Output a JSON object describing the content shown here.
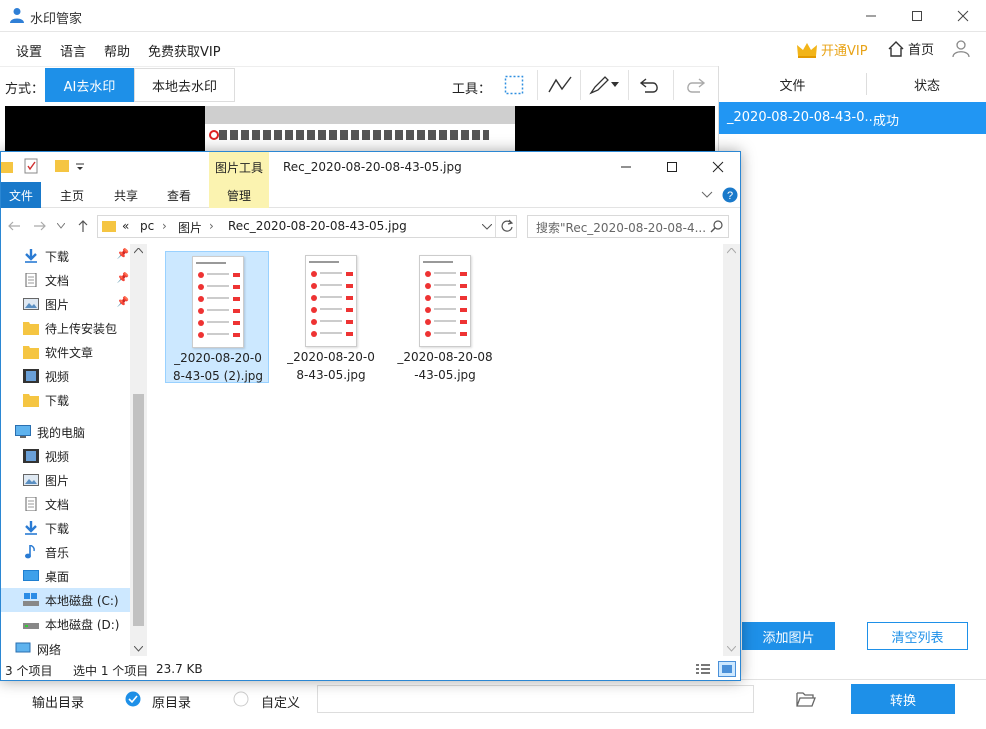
{
  "app": {
    "title": "水印管家",
    "menu": [
      "设置",
      "语言",
      "帮助",
      "免费获取VIP"
    ],
    "vip_label": "开通VIP",
    "home_label": "首页"
  },
  "toolbar": {
    "mode_label": "方式：",
    "modes": [
      "AI去水印",
      "本地去水印"
    ],
    "tools_label": "工具："
  },
  "file_list": {
    "headers": [
      "文件",
      "状态"
    ],
    "rows": [
      {
        "name": "_2020-08-20-08-43-0...",
        "status": "成功"
      }
    ],
    "add_label": "添加图片",
    "clear_label": "清空列表"
  },
  "bottom": {
    "output_label": "输出目录",
    "option_original": "原目录",
    "option_custom": "自定义",
    "convert_label": "转换"
  },
  "explorer": {
    "title": "Rec_2020-08-20-08-43-05.jpg",
    "context_tab": "图片工具",
    "ribbon_tabs": [
      "文件",
      "主页",
      "共享",
      "查看",
      "管理"
    ],
    "breadcrumb": [
      "«",
      "pc",
      "›",
      "图片",
      "›",
      "Rec_2020-08-20-08-43-05.jpg"
    ],
    "search_placeholder": "搜索\"Rec_2020-08-20-08-4...",
    "nav_items": [
      {
        "label": "下载",
        "icon": "download-arrow-icon",
        "pinned": true
      },
      {
        "label": "文档",
        "icon": "document-icon",
        "pinned": true
      },
      {
        "label": "图片",
        "icon": "pictures-icon",
        "pinned": true
      },
      {
        "label": "待上传安装包",
        "icon": "folder-icon",
        "pinned": false
      },
      {
        "label": "软件文章",
        "icon": "folder-icon",
        "pinned": false
      },
      {
        "label": "视频",
        "icon": "video-icon",
        "pinned": false
      },
      {
        "label": "下载",
        "icon": "folder-icon",
        "pinned": false
      }
    ],
    "pc_label": "我的电脑",
    "pc_items": [
      {
        "label": "视频",
        "icon": "video-icon"
      },
      {
        "label": "图片",
        "icon": "pictures-icon"
      },
      {
        "label": "文档",
        "icon": "document-icon"
      },
      {
        "label": "下载",
        "icon": "download-arrow-icon"
      },
      {
        "label": "音乐",
        "icon": "music-note-icon"
      },
      {
        "label": "桌面",
        "icon": "desktop-icon"
      },
      {
        "label": "本地磁盘 (C:)",
        "icon": "drive-icon"
      },
      {
        "label": "本地磁盘 (D:)",
        "icon": "drive-icon"
      }
    ],
    "network_label": "网络",
    "files": [
      {
        "name": "_2020-08-20-08-43-05 (2).jpg",
        "line1": "_2020-08-20-0",
        "line2": "8-43-05 (2).jpg",
        "selected": true
      },
      {
        "name": "_2020-08-20-08-43-05.jpg",
        "line1": "_2020-08-20-0",
        "line2": "8-43-05.jpg",
        "selected": false
      },
      {
        "name": "_2020-08-20-08-43-05.jpg",
        "line1": "_2020-08-20-08",
        "line2": "-43-05.jpg",
        "selected": false
      }
    ],
    "status": {
      "count": "3 个项目",
      "selection": "选中 1 个项目",
      "size": "23.7 KB"
    }
  },
  "colors": {
    "accent": "#1e90e8",
    "selection_row": "#2196f3",
    "vip_gold": "#e8a317"
  }
}
